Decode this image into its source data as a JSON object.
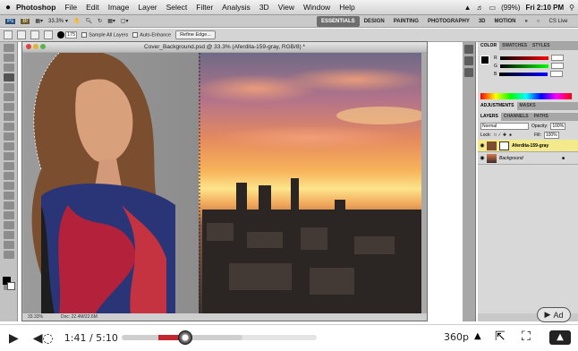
{
  "menubar": {
    "app_name": "Photoshop",
    "items": [
      "File",
      "Edit",
      "Image",
      "Layer",
      "Select",
      "Filter",
      "Analysis",
      "3D",
      "View",
      "Window",
      "Help"
    ],
    "battery_label": "(99%)",
    "clock": "Fri 2:10 PM"
  },
  "appbar": {
    "zoom": "33.3%",
    "workspaces": [
      "ESSENTIALS",
      "DESIGN",
      "PAINTING",
      "PHOTOGRAPHY",
      "3D",
      "MOTION"
    ],
    "active_workspace": "ESSENTIALS",
    "cs_live": "CS Live"
  },
  "options": {
    "brush_size": "175",
    "sample_all_layers": "Sample All Layers",
    "auto_enhance": "Auto-Enhance",
    "refine_edge": "Refine Edge..."
  },
  "document": {
    "title": "Cover_Background.psd @ 33.3% (Aferdita-159-gray, RGB/8) *",
    "status_zoom": "33.33%",
    "status_doc": "Doc: 22.4M/22.6M"
  },
  "panels": {
    "color_tabs": [
      "COLOR",
      "SWATCHES",
      "STYLES"
    ],
    "adjust_tabs": [
      "ADJUSTMENTS",
      "MASKS"
    ],
    "layer_tabs": [
      "LAYERS",
      "CHANNELS",
      "PATHS"
    ],
    "blend_mode": "Normal",
    "opacity_label": "Opacity:",
    "opacity": "100%",
    "lock_label": "Lock:",
    "fill_label": "Fill:",
    "fill": "100%",
    "layers": [
      {
        "name": "Aferdita-159-gray",
        "selected": true
      },
      {
        "name": "Background",
        "selected": false
      }
    ]
  },
  "player": {
    "current_time": "1:41",
    "duration": "5:10",
    "time_display": "1:41 / 5:10",
    "quality": "360p",
    "progress_fraction": 0.326,
    "buffered_fraction": 0.62,
    "ad_label": "Ad"
  },
  "colors": {
    "accent_red": "#c1272d",
    "selected_layer": "#f4ea8c",
    "active_workspace_bg": "#6e6e6e"
  }
}
